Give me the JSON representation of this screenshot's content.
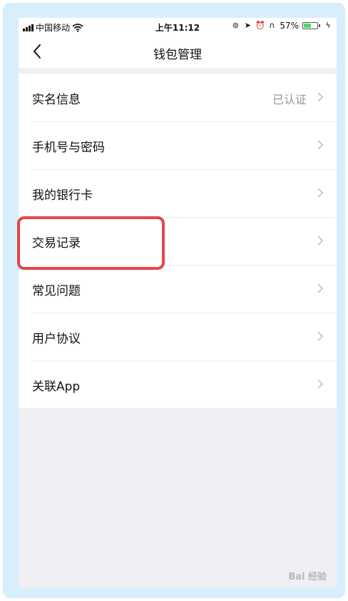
{
  "status_bar": {
    "carrier": "中国移动",
    "time": "上午11:12",
    "battery_text": "57%",
    "battery_level": 0.57,
    "icons": [
      "signal-icon",
      "wifi-icon",
      "screen-lock-icon",
      "location-icon",
      "alarm-icon",
      "headphones-icon",
      "battery-icon",
      "charging-icon"
    ]
  },
  "nav": {
    "title": "钱包管理",
    "back_icon": "chevron-left-icon"
  },
  "menu": {
    "items": [
      {
        "label": "实名信息",
        "value": "已认证"
      },
      {
        "label": "手机号与密码",
        "value": ""
      },
      {
        "label": "我的银行卡",
        "value": ""
      },
      {
        "label": "交易记录",
        "value": ""
      },
      {
        "label": "常见问题",
        "value": ""
      },
      {
        "label": "用户协议",
        "value": ""
      },
      {
        "label": "关联App",
        "value": ""
      }
    ]
  },
  "annotation": {
    "highlight_color": "#e6454b"
  },
  "watermark": {
    "text": "Bai 经验"
  }
}
